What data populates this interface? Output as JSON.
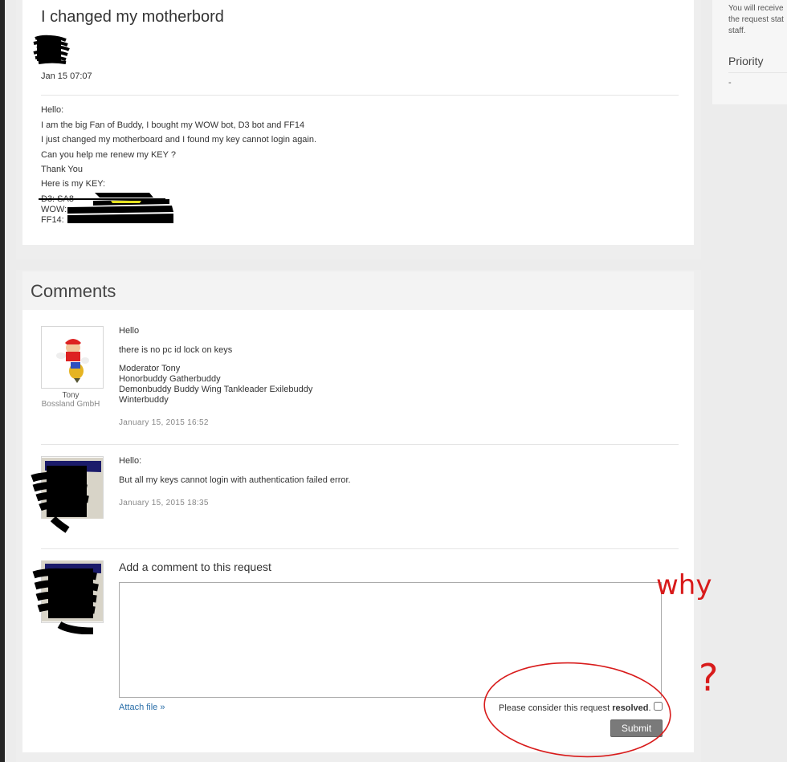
{
  "request": {
    "title": "I changed my motherbord",
    "date": "Jan 15 07:07",
    "body": [
      "Hello:",
      "I am the big Fan of Buddy, I bought my WOW bot, D3 bot and FF14",
      "I just changed my motherboard and I found my key cannot login again.",
      "Can you help me renew my KEY ?",
      "Thank You",
      "Here is my KEY:"
    ],
    "keys": [
      {
        "label": "D3: SA8"
      },
      {
        "label": "WOW:"
      },
      {
        "label": "FF14:"
      }
    ]
  },
  "comments": {
    "heading": "Comments",
    "items": [
      {
        "author": "Tony",
        "org": "Bossland GmbH",
        "greeting": "Hello",
        "text": "there is no pc id lock on keys",
        "signature": [
          "Moderator Tony",
          "Honorbuddy Gatherbuddy",
          "Demonbuddy Buddy Wing Tankleader Exilebuddy",
          "Winterbuddy"
        ],
        "date": "January 15, 2015 16:52"
      },
      {
        "greeting": "Hello:",
        "text": "But all my keys cannot login with authentication failed error.",
        "date": "January 15, 2015 18:35"
      }
    ]
  },
  "add_comment": {
    "label": "Add a comment to this request",
    "attach": "Attach file »",
    "resolve_prefix": "Please consider this request ",
    "resolve_bold": "resolved",
    "resolve_suffix": ".",
    "submit": "Submit"
  },
  "sidebar": {
    "note_lines": [
      "You will receive",
      "the request stat",
      "staff."
    ],
    "priority_label": "Priority",
    "priority_value": "-"
  },
  "annotation": {
    "word": "why",
    "mark": "?",
    "color": "#d81b1b"
  }
}
